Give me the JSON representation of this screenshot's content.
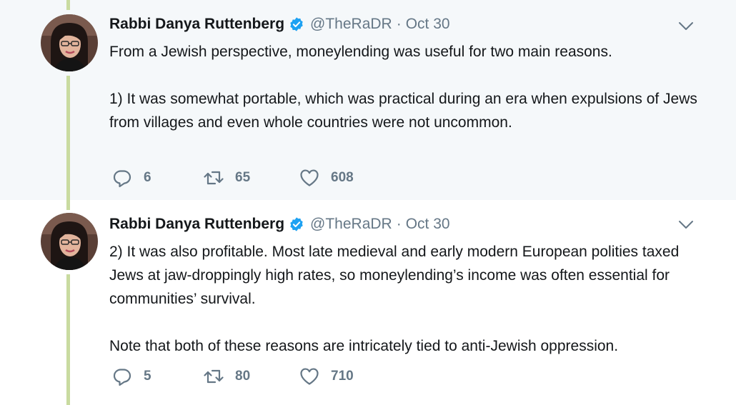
{
  "tweets": [
    {
      "author_name": "Rabbi Danya Ruttenberg",
      "handle": "@TheRaDR",
      "separator": "·",
      "date": "Oct 30",
      "paragraphs": [
        "From a Jewish perspective, moneylending was useful for two main reasons.",
        "1) It was somewhat portable, which was practical during an era when expulsions of Jews from villages and even whole countries were not uncommon."
      ],
      "replies": "6",
      "retweets": "65",
      "likes": "608"
    },
    {
      "author_name": "Rabbi Danya Ruttenberg",
      "handle": "@TheRaDR",
      "separator": "·",
      "date": "Oct 30",
      "paragraphs": [
        "2) It was also profitable. Most late medieval and early modern European polities taxed Jews at jaw-droppingly high rates, so moneylending’s income was often essential for communities’ survival.",
        "Note that both of these reasons are intricately tied to anti-Jewish oppression."
      ],
      "replies": "5",
      "retweets": "80",
      "likes": "710"
    }
  ],
  "colors": {
    "thread_line": "#c9dba0",
    "highlight_bg": "#f5f8fa",
    "verified_blue": "#1da1f2",
    "text_primary": "#14171a",
    "text_secondary": "#657786"
  },
  "icons": [
    "verified-badge-icon",
    "chevron-down-icon",
    "reply-icon",
    "retweet-icon",
    "like-icon"
  ]
}
